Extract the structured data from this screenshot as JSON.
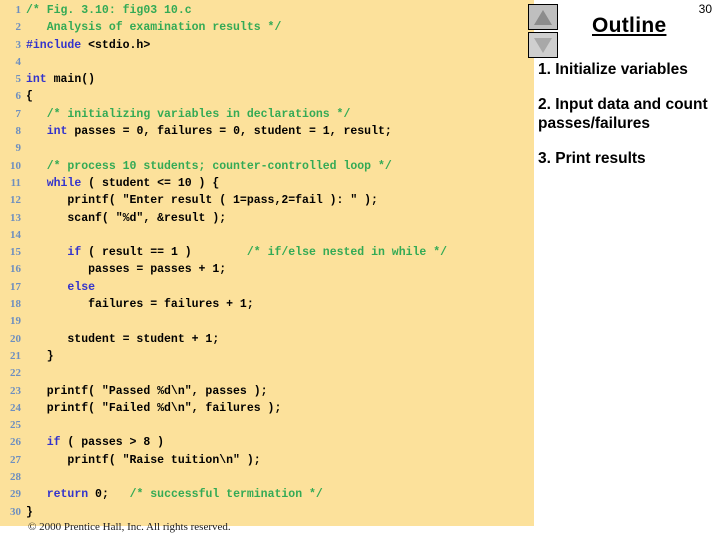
{
  "slide": {
    "page_number": "30",
    "footer": "© 2000 Prentice Hall, Inc.  All rights reserved.",
    "background_color": "#FCE19B"
  },
  "outline": {
    "title": "Outline",
    "scroll_up_label": "▲",
    "scroll_down_label": "▼",
    "items": [
      "1.  Initialize variables",
      "2.  Input data and count passes/failures",
      "3.  Print results"
    ]
  },
  "colors": {
    "keyword": "#3333CC",
    "comment": "#33AA55",
    "text": "#000000",
    "line_number": "#6E8FBF",
    "panel": "#FCE19B"
  },
  "code": {
    "language": "c",
    "lines": [
      {
        "n": "1",
        "tokens": [
          {
            "t": "/* Fig. 3.10: fig03 10.c",
            "c": "cmt"
          }
        ]
      },
      {
        "n": "2",
        "tokens": [
          {
            "t": "   Analysis of examination results */",
            "c": "cmt"
          }
        ]
      },
      {
        "n": "3",
        "tokens": [
          {
            "t": "#include",
            "c": "pp"
          },
          {
            "t": " <stdio.h>",
            "c": "plain"
          }
        ]
      },
      {
        "n": "4",
        "tokens": [
          {
            "t": "",
            "c": "plain"
          }
        ]
      },
      {
        "n": "5",
        "tokens": [
          {
            "t": "int",
            "c": "kw"
          },
          {
            "t": " main()",
            "c": "plain"
          }
        ]
      },
      {
        "n": "6",
        "tokens": [
          {
            "t": "{",
            "c": "plain"
          }
        ]
      },
      {
        "n": "7",
        "tokens": [
          {
            "t": "   /* initializing variables in declarations */",
            "c": "cmt"
          }
        ]
      },
      {
        "n": "8",
        "tokens": [
          {
            "t": "   ",
            "c": "plain"
          },
          {
            "t": "int",
            "c": "kw"
          },
          {
            "t": " passes = 0, failures = 0, student = 1, result;",
            "c": "plain"
          }
        ]
      },
      {
        "n": "9",
        "tokens": [
          {
            "t": "",
            "c": "plain"
          }
        ]
      },
      {
        "n": "10",
        "tokens": [
          {
            "t": "   /* process 10 students; counter-controlled loop */",
            "c": "cmt"
          }
        ]
      },
      {
        "n": "11",
        "tokens": [
          {
            "t": "   ",
            "c": "plain"
          },
          {
            "t": "while",
            "c": "kw"
          },
          {
            "t": " ( student <= 10 ) {",
            "c": "plain"
          }
        ]
      },
      {
        "n": "12",
        "tokens": [
          {
            "t": "      printf( \"Enter result ( 1=pass,2=fail ): \" );",
            "c": "plain"
          }
        ]
      },
      {
        "n": "13",
        "tokens": [
          {
            "t": "      scanf( \"%d\", &result );",
            "c": "plain"
          }
        ]
      },
      {
        "n": "14",
        "tokens": [
          {
            "t": "",
            "c": "plain"
          }
        ]
      },
      {
        "n": "15",
        "tokens": [
          {
            "t": "      ",
            "c": "plain"
          },
          {
            "t": "if",
            "c": "kw"
          },
          {
            "t": " ( result == 1 )        ",
            "c": "plain"
          },
          {
            "t": "/* if/else nested in while */",
            "c": "cmt"
          }
        ]
      },
      {
        "n": "16",
        "tokens": [
          {
            "t": "         passes = passes + 1;",
            "c": "plain"
          }
        ]
      },
      {
        "n": "17",
        "tokens": [
          {
            "t": "      ",
            "c": "plain"
          },
          {
            "t": "else",
            "c": "kw"
          }
        ]
      },
      {
        "n": "18",
        "tokens": [
          {
            "t": "         failures = failures + 1;",
            "c": "plain"
          }
        ]
      },
      {
        "n": "19",
        "tokens": [
          {
            "t": "",
            "c": "plain"
          }
        ]
      },
      {
        "n": "20",
        "tokens": [
          {
            "t": "      student = student + 1;",
            "c": "plain"
          }
        ]
      },
      {
        "n": "21",
        "tokens": [
          {
            "t": "   }",
            "c": "plain"
          }
        ]
      },
      {
        "n": "22",
        "tokens": [
          {
            "t": "",
            "c": "plain"
          }
        ]
      },
      {
        "n": "23",
        "tokens": [
          {
            "t": "   printf( \"Passed %d\\n\", passes );",
            "c": "plain"
          }
        ]
      },
      {
        "n": "24",
        "tokens": [
          {
            "t": "   printf( \"Failed %d\\n\", failures );",
            "c": "plain"
          }
        ]
      },
      {
        "n": "25",
        "tokens": [
          {
            "t": "",
            "c": "plain"
          }
        ]
      },
      {
        "n": "26",
        "tokens": [
          {
            "t": "   ",
            "c": "plain"
          },
          {
            "t": "if",
            "c": "kw"
          },
          {
            "t": " ( passes > 8 )",
            "c": "plain"
          }
        ]
      },
      {
        "n": "27",
        "tokens": [
          {
            "t": "      printf( \"Raise tuition\\n\" );",
            "c": "plain"
          }
        ]
      },
      {
        "n": "28",
        "tokens": [
          {
            "t": "",
            "c": "plain"
          }
        ]
      },
      {
        "n": "29",
        "tokens": [
          {
            "t": "   ",
            "c": "plain"
          },
          {
            "t": "return",
            "c": "kw"
          },
          {
            "t": " 0;   ",
            "c": "plain"
          },
          {
            "t": "/* successful termination */",
            "c": "cmt"
          }
        ]
      },
      {
        "n": "30",
        "tokens": [
          {
            "t": "}",
            "c": "plain"
          }
        ]
      }
    ]
  }
}
